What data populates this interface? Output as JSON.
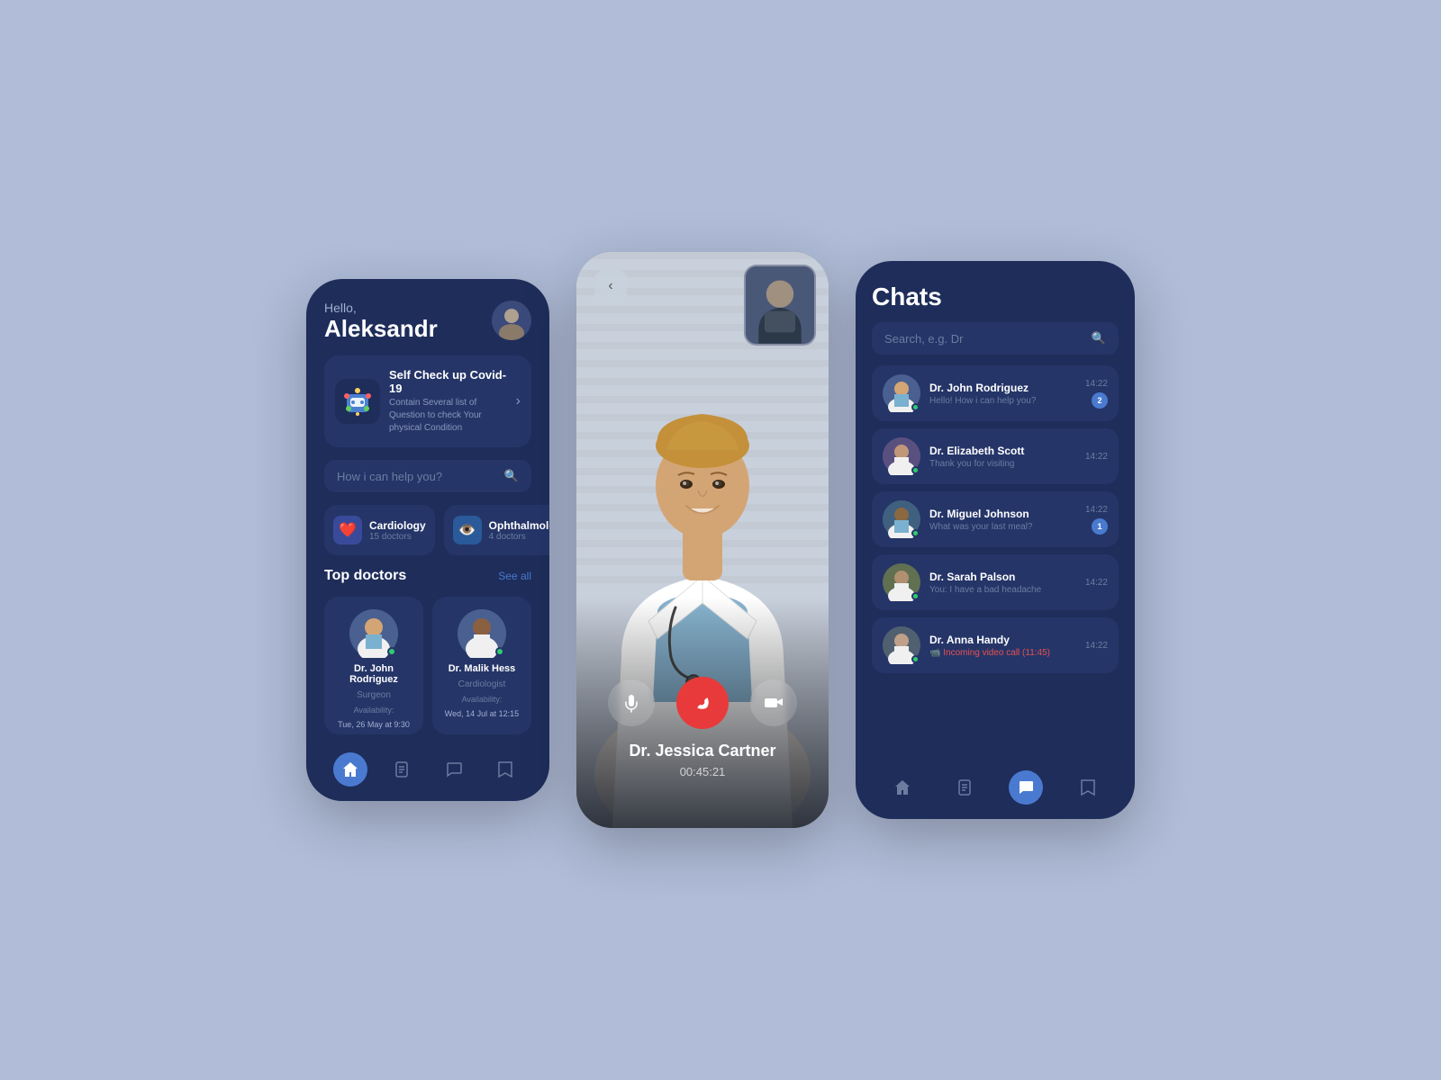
{
  "app": {
    "bg_color": "#b0bcd8"
  },
  "phone_home": {
    "greeting": "Hello,",
    "user_name": "Aleksandr",
    "covid_card": {
      "title": "Self Check up Covid-19",
      "subtitle": "Contain Several list of Question to check Your physical Condition"
    },
    "search_placeholder": "How i can help you?",
    "categories": [
      {
        "name": "Cardiology",
        "count": "15 doctors",
        "icon": "❤️"
      },
      {
        "name": "Ophthalmology",
        "count": "4 doctors",
        "icon": "👁️"
      }
    ],
    "top_doctors_label": "Top doctors",
    "see_all_label": "See all",
    "doctors": [
      {
        "name": "Dr. John Rodriguez",
        "specialty": "Surgeon",
        "avail_label": "Availability:",
        "avail_time": "Tue, 26 May at 9:30"
      },
      {
        "name": "Dr. Malik Hess",
        "specialty": "Cardiologist",
        "avail_label": "Availability:",
        "avail_time": "Wed, 14 Jul at 12:15"
      }
    ],
    "nav": {
      "home": "home",
      "records": "records",
      "chat": "chat",
      "saved": "saved"
    }
  },
  "phone_video": {
    "doctor_name": "Dr. Jessica Cartner",
    "call_duration": "00:45:21",
    "back_icon": "‹"
  },
  "phone_chats": {
    "title": "Chats",
    "search_placeholder": "Search, e.g. Dr",
    "chats": [
      {
        "name": "Dr. John Rodriguez",
        "preview": "Hello! How i can help you?",
        "time": "14:22",
        "badge": "2",
        "online": true
      },
      {
        "name": "Dr. Elizabeth Scott",
        "preview": "Thank you for visiting",
        "time": "14:22",
        "badge": "",
        "online": true
      },
      {
        "name": "Dr. Miguel Johnson",
        "preview": "What was your last meal?",
        "time": "14:22",
        "badge": "1",
        "online": true
      },
      {
        "name": "Dr. Sarah Palson",
        "preview": "You: I have a bad headache",
        "time": "14:22",
        "badge": "",
        "online": true
      },
      {
        "name": "Dr. Anna Handy",
        "preview": "📹 Incoming video call (11:45)",
        "time": "14:22",
        "badge": "",
        "online": true,
        "is_video_call": true
      }
    ]
  }
}
